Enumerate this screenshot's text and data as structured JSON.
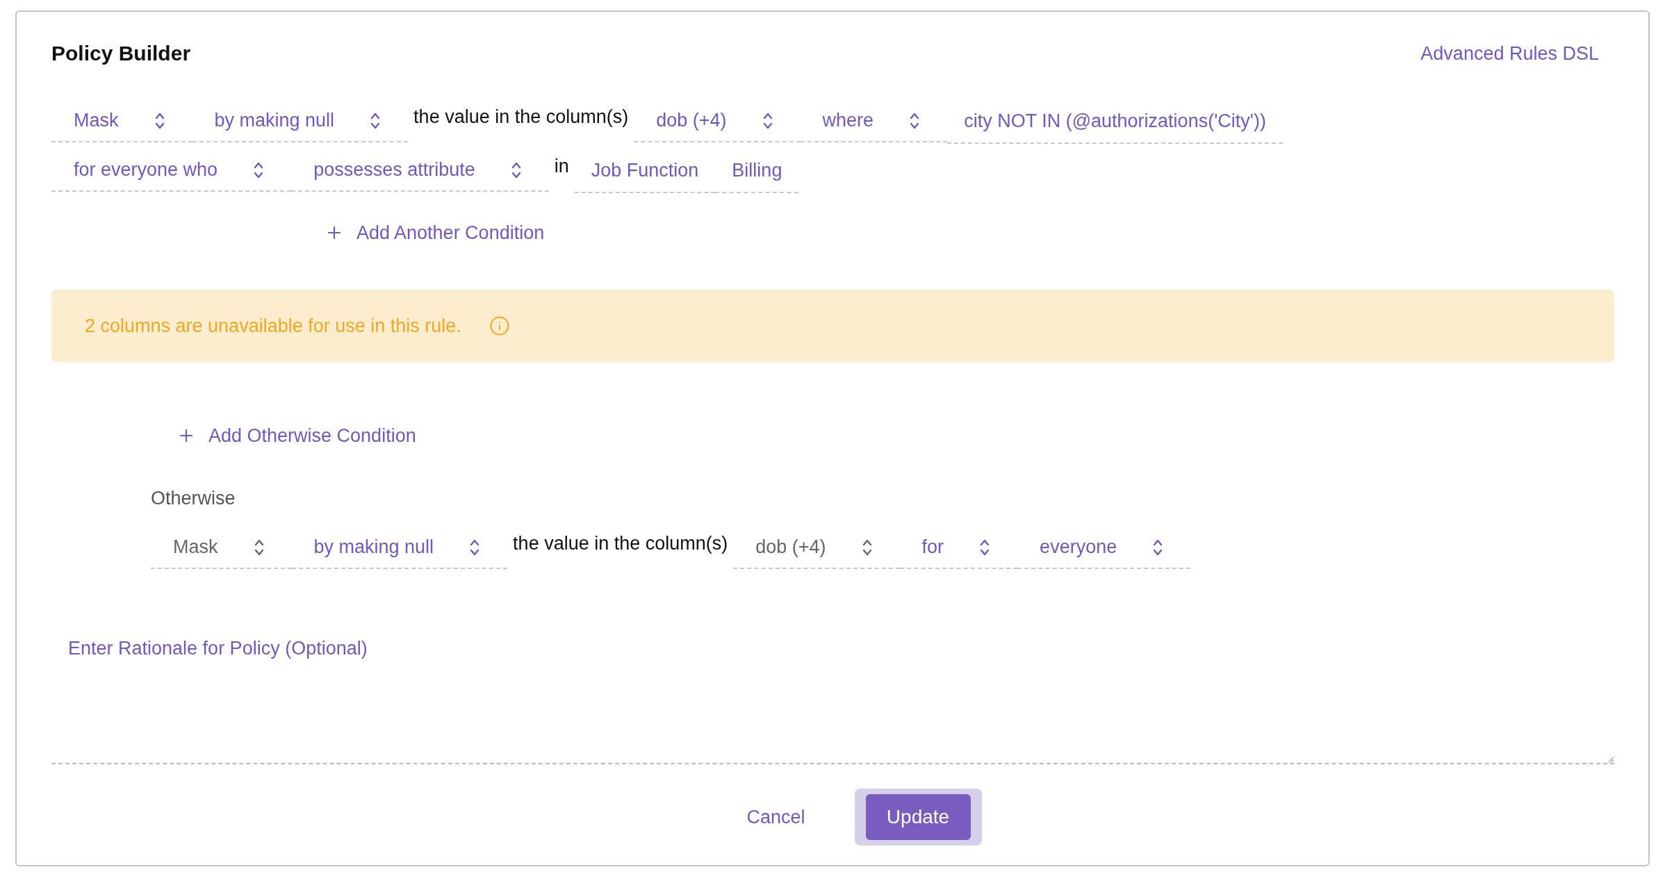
{
  "title": "Policy Builder",
  "dsl_link": "Advanced Rules DSL",
  "rule_rows": [
    [
      {
        "kind": "select",
        "label": "Mask",
        "disabled": false
      },
      {
        "kind": "select",
        "label": "by making null",
        "disabled": false
      },
      {
        "kind": "text",
        "label": "the value in the column(s)"
      },
      {
        "kind": "select",
        "label": "dob (+4)",
        "disabled": false
      },
      {
        "kind": "select",
        "label": "where",
        "disabled": false
      },
      {
        "kind": "chip",
        "label": "city NOT IN (@authorizations('City'))"
      }
    ],
    [
      {
        "kind": "select",
        "label": "for everyone who",
        "disabled": false
      },
      {
        "kind": "select",
        "label": "possesses attribute",
        "disabled": false
      },
      {
        "kind": "text",
        "label": "in"
      },
      {
        "kind": "chip",
        "label": "Job Function"
      },
      {
        "kind": "chip",
        "label": "Billing"
      }
    ]
  ],
  "add_condition": "Add Another Condition",
  "notice": {
    "text": "2 columns are unavailable for use in this rule."
  },
  "add_otherwise": "Add Otherwise Condition",
  "otherwise": {
    "label": "Otherwise",
    "row": [
      {
        "kind": "select",
        "label": "Mask",
        "disabled": true
      },
      {
        "kind": "select",
        "label": "by making null",
        "disabled": false
      },
      {
        "kind": "text",
        "label": "the value in the column(s)"
      },
      {
        "kind": "select",
        "label": "dob (+4)",
        "disabled": true
      },
      {
        "kind": "select",
        "label": "for",
        "disabled": false
      },
      {
        "kind": "select",
        "label": "everyone",
        "disabled": false
      }
    ]
  },
  "rationale": {
    "placeholder": "Enter Rationale for Policy (Optional)"
  },
  "buttons": [
    {
      "kind": "link",
      "label": "Cancel"
    },
    {
      "kind": "primary",
      "label": "Update"
    }
  ]
}
